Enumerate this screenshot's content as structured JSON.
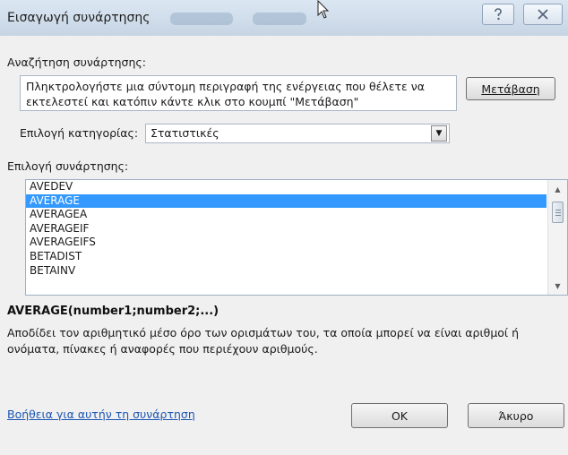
{
  "window": {
    "title": "Εισαγωγή συνάρτησης",
    "help_icon": "question-mark-icon",
    "close_icon": "close-icon"
  },
  "search": {
    "label": "Αναζήτηση συνάρτησης:",
    "value": "Πληκτρολογήστε μια σύντομη περιγραφή της ενέργειας που θέλετε να εκτελεστεί και κατόπιν κάντε κλικ στο κουμπί \"Μετάβαση\"",
    "go_button": "Μετάβαση"
  },
  "category": {
    "label": "Επιλογή κατηγορίας:",
    "selected": "Στατιστικές"
  },
  "functions": {
    "label": "Επιλογή συνάρτησης:",
    "items": [
      "AVEDEV",
      "AVERAGE",
      "AVERAGEA",
      "AVERAGEIF",
      "AVERAGEIFS",
      "BETADIST",
      "BETAINV"
    ],
    "selected_index": 1
  },
  "details": {
    "signature": "AVERAGE(number1;number2;...)",
    "description": "Αποδίδει τον αριθμητικό μέσο όρο των ορισμάτων του, τα οποία μπορεί να είναι αριθμοί ή ονόματα, πίνακες ή αναφορές που περιέχουν αριθμούς."
  },
  "footer": {
    "help_link": "Βοήθεια για αυτήν τη συνάρτηση",
    "ok": "OK",
    "cancel": "Άκυρο"
  }
}
